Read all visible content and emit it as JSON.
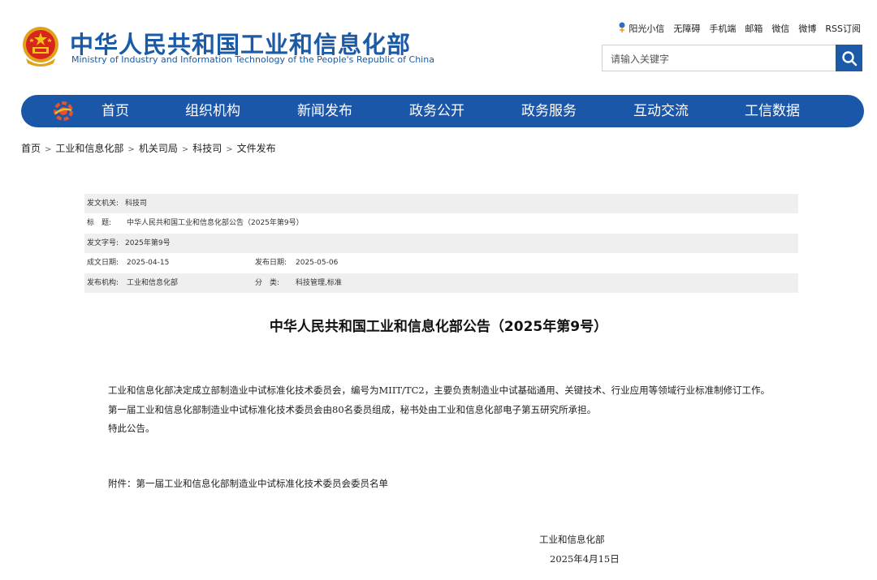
{
  "header": {
    "site_name": "中华人民共和国工业和信息化部",
    "site_name_en": "Ministry of Industry and Information Technology of the People's Republic of China",
    "top_links": [
      "阳光小信",
      "无障碍",
      "手机端",
      "邮箱",
      "微信",
      "微博",
      "RSS订阅"
    ],
    "search_placeholder": "请输入关键字"
  },
  "nav": {
    "items": [
      "首页",
      "组织机构",
      "新闻发布",
      "政务公开",
      "政务服务",
      "互动交流",
      "工信数据"
    ]
  },
  "breadcrumb": [
    "首页",
    "工业和信息化部",
    "机关司局",
    "科技司",
    "文件发布"
  ],
  "meta": {
    "issuer_label": "发文机关:",
    "issuer": "科技司",
    "title_label": "标　题:",
    "title": "中华人民共和国工业和信息化部公告（2025年第9号）",
    "doc_no_label": "发文字号:",
    "doc_no": "2025年第9号",
    "written_date_label": "成文日期:",
    "written_date": "2025-04-15",
    "publish_date_label": "发布日期:",
    "publish_date": "2025-05-06",
    "publisher_label": "发布机构:",
    "publisher": "工业和信息化部",
    "category_label": "分　类:",
    "category": "科技管理,标准"
  },
  "article": {
    "title": "中华人民共和国工业和信息化部公告（2025年第9号）",
    "paragraphs": [
      "工业和信息化部决定成立部制造业中试标准化技术委员会，编号为MIIT/TC2，主要负责制造业中试基础通用、关键技术、行业应用等领域行业标准制修订工作。",
      "第一届工业和信息化部制造业中试标准化技术委员会由80名委员组成，秘书处由工业和信息化部电子第五研究所承担。",
      "特此公告。"
    ],
    "attachment": "附件：第一届工业和信息化部制造业中试标准化技术委员会委员名单",
    "signature_org": "工业和信息化部",
    "signature_date": "2025年4月15日"
  },
  "colors": {
    "brand_blue": "#1b57a8",
    "row_shade": "#efefef"
  },
  "icons": {
    "emblem": "national-emblem-icon",
    "nav_logo": "miit-logo-icon",
    "search": "search-icon",
    "sun": "sunshine-icon"
  }
}
